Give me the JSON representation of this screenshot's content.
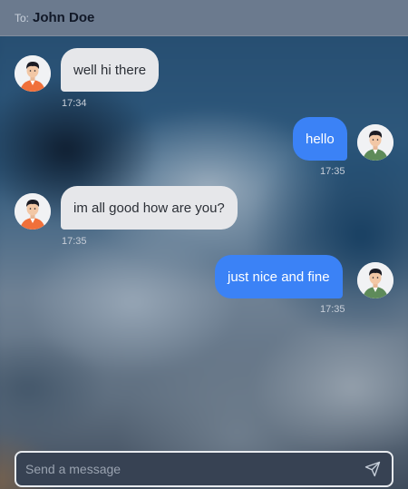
{
  "header": {
    "to_prefix": "To:",
    "recipient": "John Doe"
  },
  "messages": [
    {
      "direction": "incoming",
      "text": "well hi there",
      "time": "17:34"
    },
    {
      "direction": "outgoing",
      "text": "hello",
      "time": "17:35"
    },
    {
      "direction": "incoming",
      "text": "im all good how are you?",
      "time": "17:35"
    },
    {
      "direction": "outgoing",
      "text": "just nice and fine",
      "time": "17:35"
    }
  ],
  "composer": {
    "placeholder": "Send a message",
    "value": "",
    "send_icon": "send-icon"
  },
  "colors": {
    "header_bg": "#6b7a8e",
    "incoming_bubble": "#e6e7ea",
    "outgoing_bubble": "#3b82f6",
    "composer_bg": "#374253",
    "incoming_avatar_shirt": "#f0703a",
    "outgoing_avatar_shirt": "#5e8b5a"
  }
}
